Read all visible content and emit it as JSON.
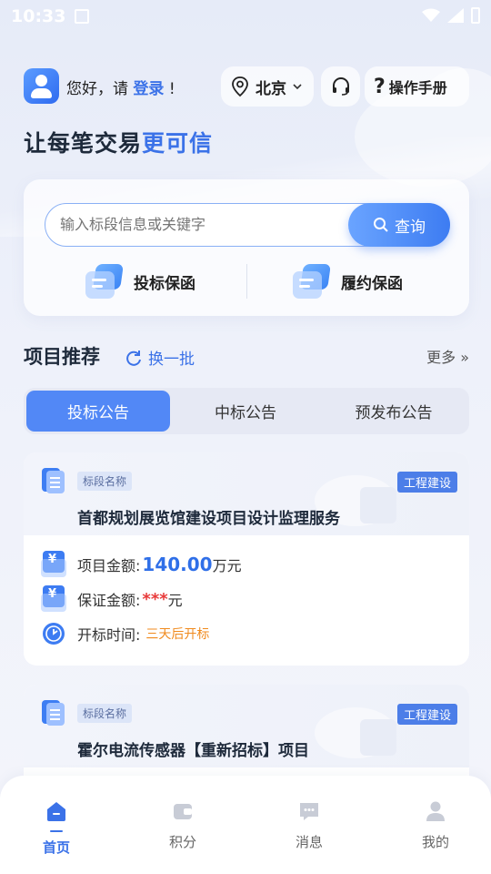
{
  "status": {
    "time": "10:33"
  },
  "header": {
    "greeting_prefix": "您好，请 ",
    "login_label": "登录",
    "greeting_suffix": "!",
    "city": "北京",
    "manual_label": "操作手册"
  },
  "slogan": {
    "main": "让每笔交易",
    "highlight": "更可信"
  },
  "search": {
    "placeholder": "输入标段信息或关键字",
    "button_label": "查询"
  },
  "services": [
    {
      "label": "投标保函",
      "icon": "bid-guarantee-icon"
    },
    {
      "label": "履约保函",
      "icon": "performance-guarantee-icon"
    }
  ],
  "recommend": {
    "title": "项目推荐",
    "refresh_label": "换一批",
    "more_label": "更多 »",
    "tabs": [
      {
        "label": "投标公告",
        "active": true
      },
      {
        "label": "中标公告",
        "active": false
      },
      {
        "label": "预发布公告",
        "active": false
      }
    ]
  },
  "projects": [
    {
      "tag_name": "标段名称",
      "tag_type": "工程建设",
      "title": "首都规划展览馆建设项目设计监理服务",
      "amount_label": "项目金额:",
      "amount": "140.00",
      "amount_unit": "万元",
      "deposit_label": "保证金额:",
      "deposit": "***",
      "deposit_unit": "元",
      "open_label": "开标时间:",
      "open_time": "三天后开标"
    },
    {
      "tag_name": "标段名称",
      "tag_type": "工程建设",
      "title": "霍尔电流传感器【重新招标】项目"
    }
  ],
  "nav": [
    {
      "label": "首页",
      "active": true,
      "icon": "home-icon"
    },
    {
      "label": "积分",
      "active": false,
      "icon": "wallet-icon"
    },
    {
      "label": "消息",
      "active": false,
      "icon": "message-icon"
    },
    {
      "label": "我的",
      "active": false,
      "icon": "user-icon"
    }
  ],
  "colors": {
    "accent": "#3b72e8",
    "warning": "#f08a1d",
    "danger": "#e83a3a"
  }
}
